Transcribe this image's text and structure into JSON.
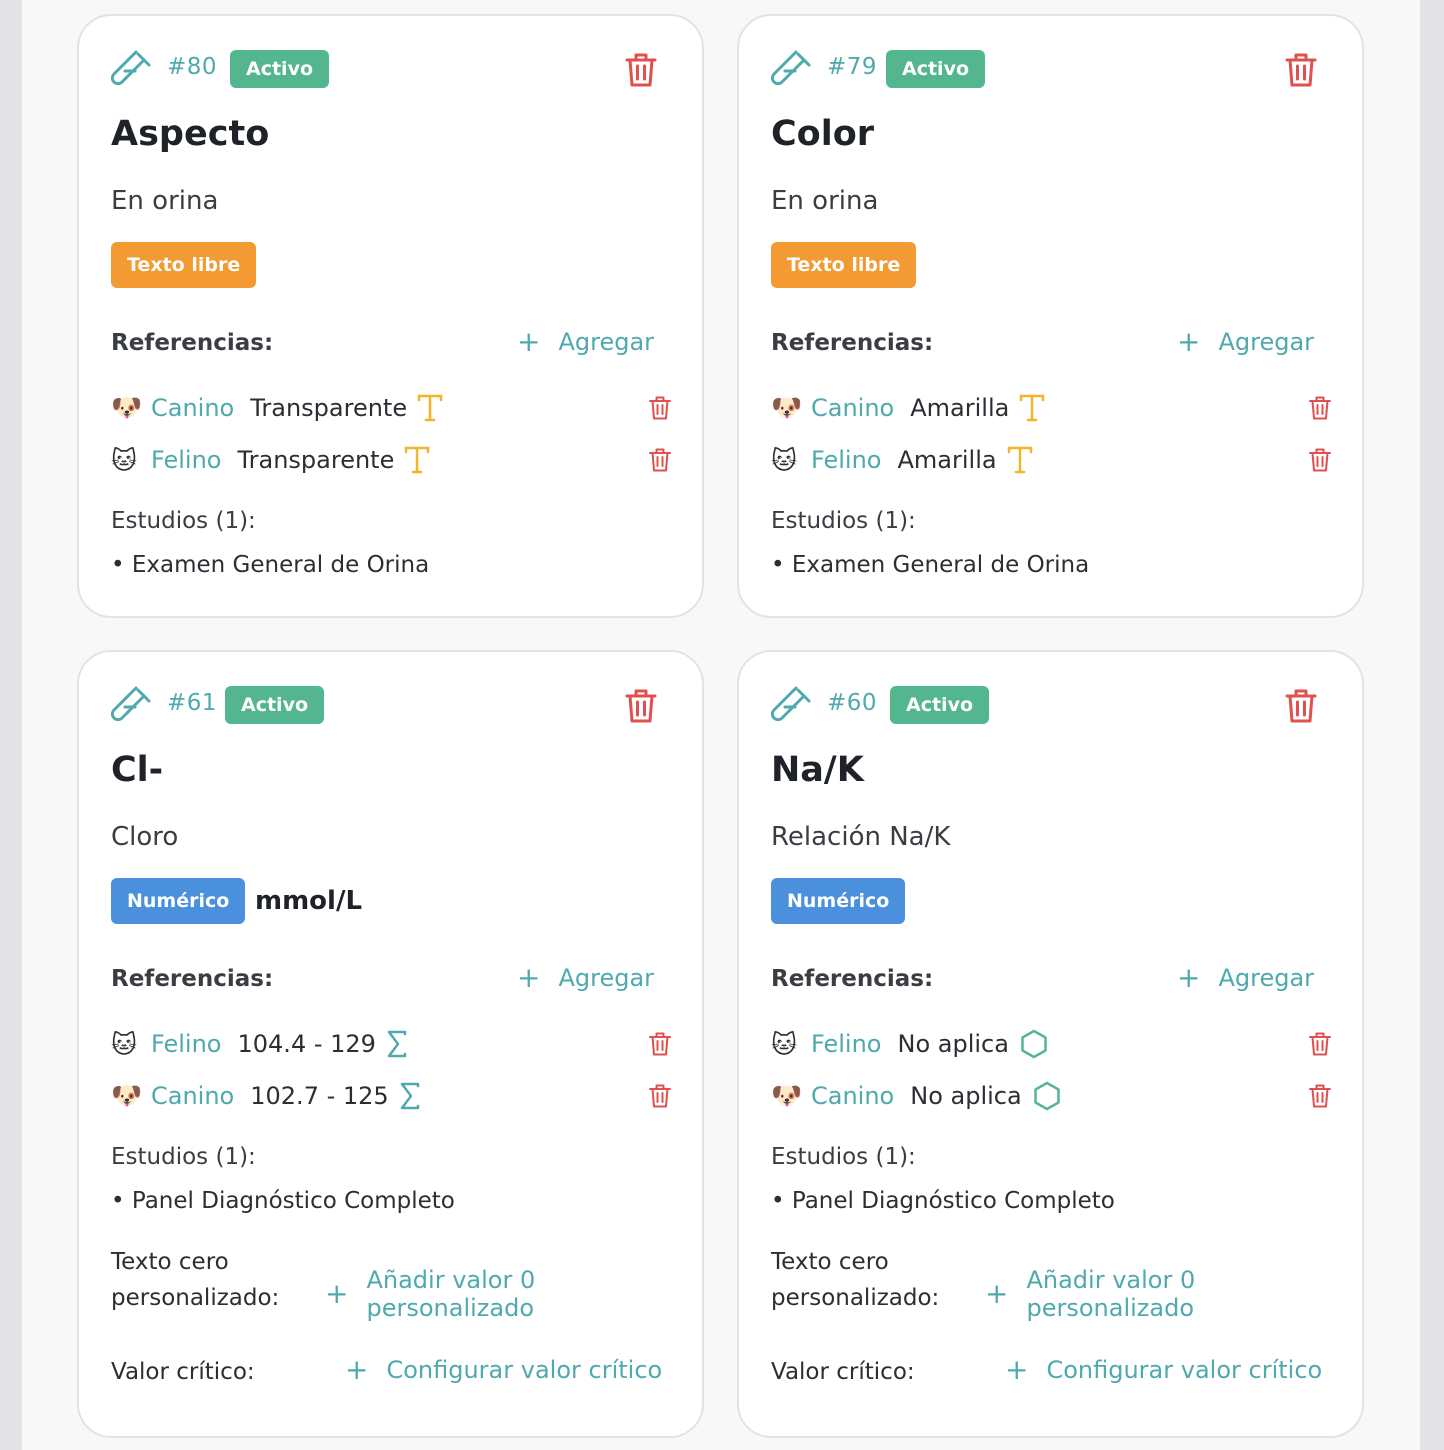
{
  "labels": {
    "references": "Referencias:",
    "add": "Agregar",
    "studies": "Estudios (1):",
    "zero_text": "Texto cero personalizado:",
    "zero_add": "Añadir valor 0 personalizado",
    "critical": "Valor crítico:",
    "critical_add": "Configurar valor crítico"
  },
  "colors": {
    "accent": "#4fa9ad",
    "status_active": "#54b68f",
    "type_text": "#f39a32",
    "type_numeric": "#4a90dd",
    "delete": "#e0504f",
    "text_icon": "#f2b52a"
  },
  "cards": [
    {
      "id": "#80",
      "status": "Activo",
      "title": "Aspecto",
      "subtitle": "En orina",
      "type": "Texto libre",
      "unit": "",
      "references": [
        {
          "emoji": "🐶",
          "species": "Canino",
          "value": "Transparente",
          "icon": "text-type-icon"
        },
        {
          "emoji": "🐱",
          "species": "Felino",
          "value": "Transparente",
          "icon": "text-type-icon"
        }
      ],
      "studies": [
        "• Examen General de Orina"
      ]
    },
    {
      "id": "#79",
      "status": "Activo",
      "title": "Color",
      "subtitle": "En orina",
      "type": "Texto libre",
      "unit": "",
      "references": [
        {
          "emoji": "🐶",
          "species": "Canino",
          "value": "Amarilla",
          "icon": "text-type-icon"
        },
        {
          "emoji": "🐱",
          "species": "Felino",
          "value": "Amarilla",
          "icon": "text-type-icon"
        }
      ],
      "studies": [
        "• Examen General de Orina"
      ]
    },
    {
      "id": "#61",
      "status": "Activo",
      "title": "Cl-",
      "subtitle": "Cloro",
      "type": "Numérico",
      "unit": "mmol/L",
      "references": [
        {
          "emoji": "🐱",
          "species": "Felino",
          "value": "104.4 - 129",
          "icon": "sigma-icon"
        },
        {
          "emoji": "🐶",
          "species": "Canino",
          "value": "102.7 - 125",
          "icon": "sigma-icon"
        }
      ],
      "studies": [
        "• Panel Diagnóstico Completo"
      ]
    },
    {
      "id": "#60",
      "status": "Activo",
      "title": "Na/K",
      "subtitle": "Relación Na/K",
      "type": "Numérico",
      "unit": "",
      "references": [
        {
          "emoji": "🐱",
          "species": "Felino",
          "value": "No aplica",
          "icon": "hexagon-icon"
        },
        {
          "emoji": "🐶",
          "species": "Canino",
          "value": "No aplica",
          "icon": "hexagon-icon"
        }
      ],
      "studies": [
        "• Panel Diagnóstico Completo"
      ]
    }
  ]
}
